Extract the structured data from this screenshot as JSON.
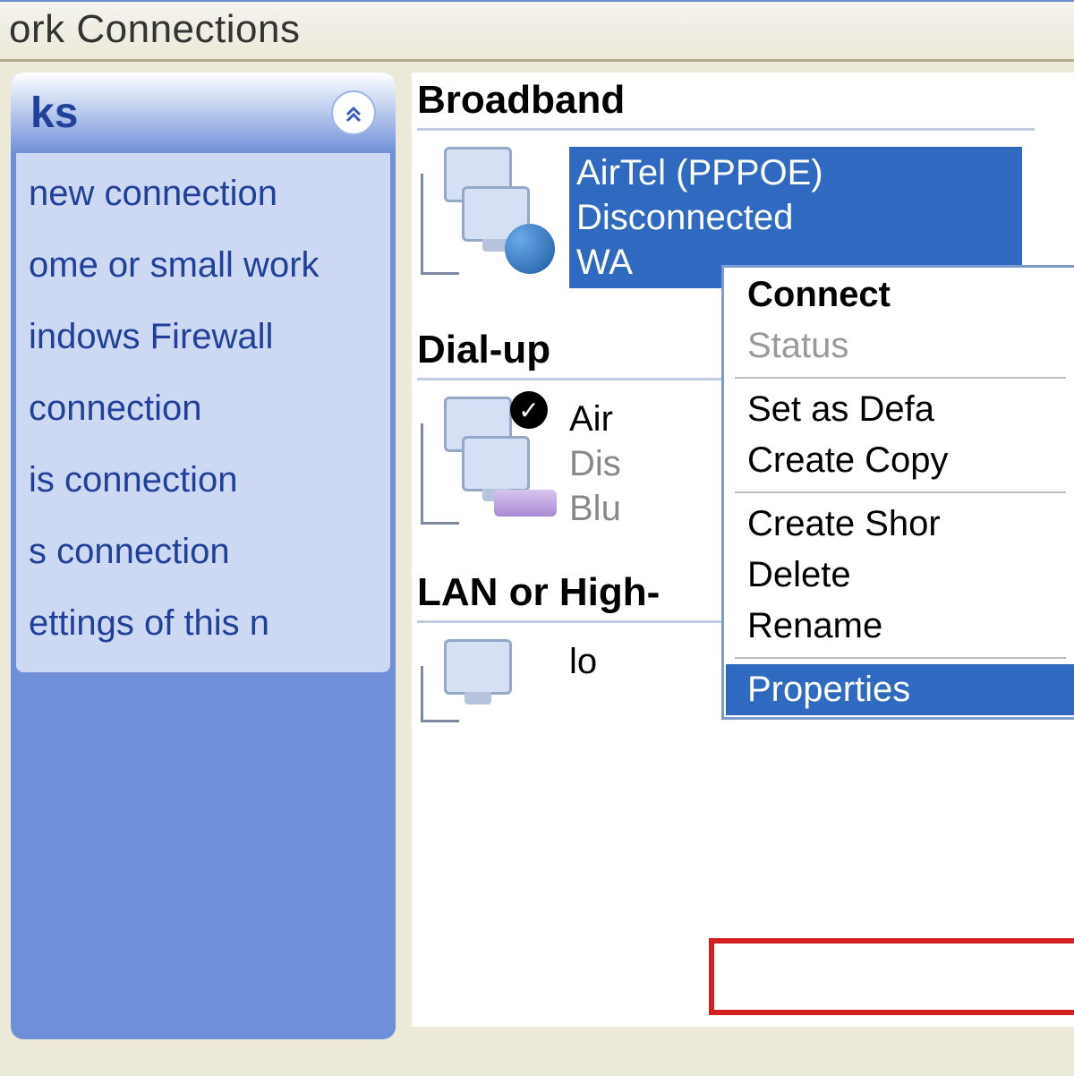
{
  "window": {
    "title": "ork Connections"
  },
  "sidebar": {
    "panel_title": "ks",
    "tasks": [
      "new connection",
      "ome or small work",
      "indows Firewall",
      "connection",
      "is connection",
      "s connection",
      "ettings of this n"
    ]
  },
  "main": {
    "groups": [
      {
        "label": "Broadband",
        "items": [
          {
            "name": "AirTel (PPPOE)",
            "status": "Disconnected",
            "device": "WA",
            "selected": true,
            "default": false,
            "kind": "broadband"
          }
        ]
      },
      {
        "label": "Dial-up",
        "items": [
          {
            "name": "Air",
            "status": "Dis",
            "device": "Blu",
            "selected": false,
            "default": true,
            "kind": "dialup"
          }
        ]
      },
      {
        "label": "LAN or High-",
        "items": [
          {
            "name": "lo",
            "status": "",
            "device": "",
            "selected": false,
            "default": false,
            "kind": "lan"
          }
        ]
      }
    ]
  },
  "context_menu": {
    "items": [
      {
        "label": "Connect",
        "bold": true,
        "disabled": false
      },
      {
        "label": "Status",
        "bold": false,
        "disabled": true
      },
      {
        "sep": true
      },
      {
        "label": "Set as Defa",
        "bold": false,
        "disabled": false
      },
      {
        "label": "Create Copy",
        "bold": false,
        "disabled": false
      },
      {
        "sep": true
      },
      {
        "label": "Create Shor",
        "bold": false,
        "disabled": false
      },
      {
        "label": "Delete",
        "bold": false,
        "disabled": false
      },
      {
        "label": "Rename",
        "bold": false,
        "disabled": false
      },
      {
        "sep": true
      },
      {
        "label": "Properties",
        "bold": false,
        "disabled": false,
        "hover": true,
        "highlight": true
      }
    ]
  }
}
